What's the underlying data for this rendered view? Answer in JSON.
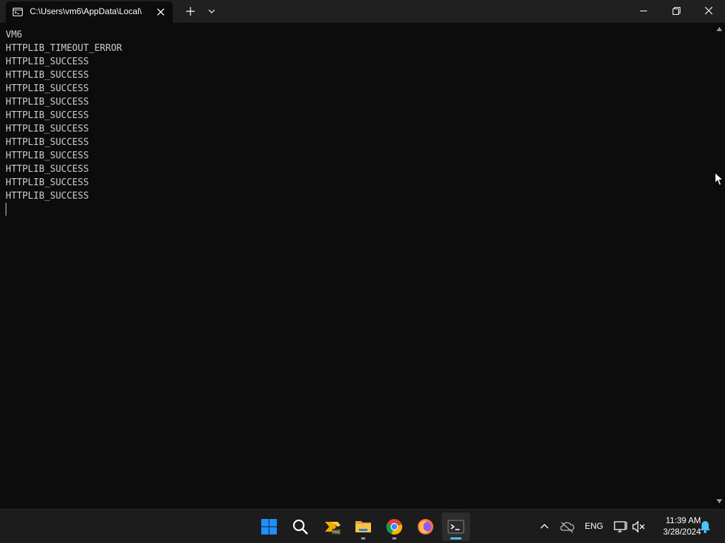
{
  "window": {
    "tab_title": "C:\\Users\\vm6\\AppData\\Local\\"
  },
  "terminal": {
    "lines": [
      "VM6",
      "HTTPLIB_TIMEOUT_ERROR",
      "HTTPLIB_SUCCESS",
      "HTTPLIB_SUCCESS",
      "HTTPLIB_SUCCESS",
      "HTTPLIB_SUCCESS",
      "HTTPLIB_SUCCESS",
      "HTTPLIB_SUCCESS",
      "HTTPLIB_SUCCESS",
      "HTTPLIB_SUCCESS",
      "HTTPLIB_SUCCESS",
      "HTTPLIB_SUCCESS",
      "HTTPLIB_SUCCESS"
    ]
  },
  "taskbar": {
    "apps": [
      "start-icon",
      "search-icon",
      "power-automate-icon",
      "file-explorer-icon",
      "chrome-icon",
      "firefox-icon",
      "terminal-icon"
    ],
    "tray": {
      "language": "ENG",
      "time": "11:39 AM",
      "date": "3/28/2024"
    }
  },
  "colors": {
    "terminal_bg": "#0c0c0c",
    "terminal_text": "#cccccc",
    "titlebar_bg": "#202020",
    "taskbar_bg": "#1c1c1c",
    "accent": "#4cc2ff"
  }
}
